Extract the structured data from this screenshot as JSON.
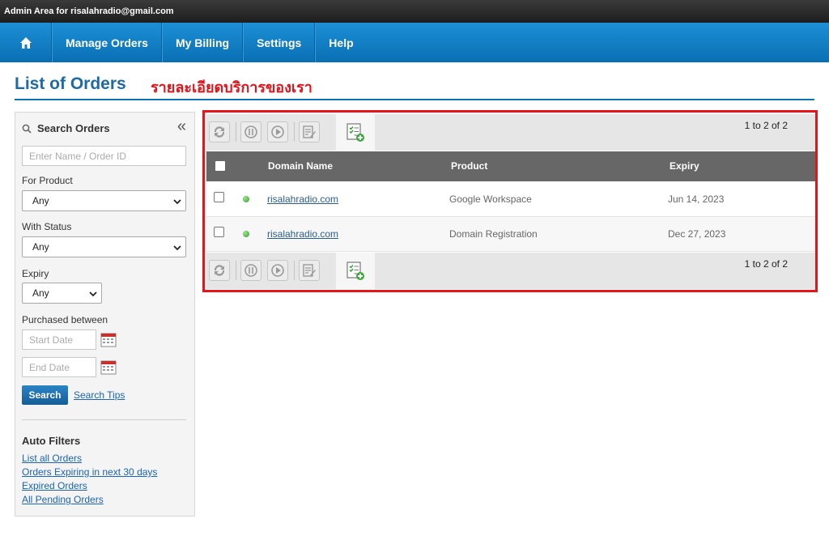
{
  "topbar": {
    "text": "Admin Area for risalahradio@gmail.com"
  },
  "nav": {
    "home_icon": "home-icon",
    "items": [
      {
        "label": "Manage Orders"
      },
      {
        "label": "My Billing"
      },
      {
        "label": "Settings"
      },
      {
        "label": "Help"
      }
    ]
  },
  "page": {
    "title": "List of Orders",
    "subtitle": "รายละเอียดบริการของเรา"
  },
  "sidebar": {
    "title": "Search Orders",
    "collapse_icon": "«",
    "search_placeholder": "Enter Name / Order ID",
    "product_label": "For Product",
    "product_value": "Any",
    "status_label": "With Status",
    "status_value": "Any",
    "expiry_label": "Expiry",
    "expiry_value": "Any",
    "purchased_label": "Purchased between",
    "start_placeholder": "Start Date",
    "end_placeholder": "End Date",
    "search_button": "Search",
    "search_tips": "Search Tips",
    "auto_filters_title": "Auto Filters",
    "auto_filters": [
      {
        "label": "List all Orders"
      },
      {
        "label": "Orders Expiring in next 30 days"
      },
      {
        "label": "Expired Orders"
      },
      {
        "label": "All Pending Orders"
      }
    ]
  },
  "orders": {
    "pager": "1 to 2 of 2",
    "columns": {
      "domain": "Domain Name",
      "product": "Product",
      "expiry": "Expiry"
    },
    "rows": [
      {
        "domain": "risalahradio.com",
        "product": "Google Workspace",
        "expiry": "Jun 14, 2023",
        "status_color": "#3aa83a"
      },
      {
        "domain": "risalahradio.com",
        "product": "Domain Registration",
        "expiry": "Dec 27, 2023",
        "status_color": "#3aa83a"
      }
    ]
  },
  "colors": {
    "nav_blue": "#1280c4",
    "title_blue": "#1d6aa7",
    "highlight_red": "#e8141a",
    "header_gray": "#676767"
  }
}
